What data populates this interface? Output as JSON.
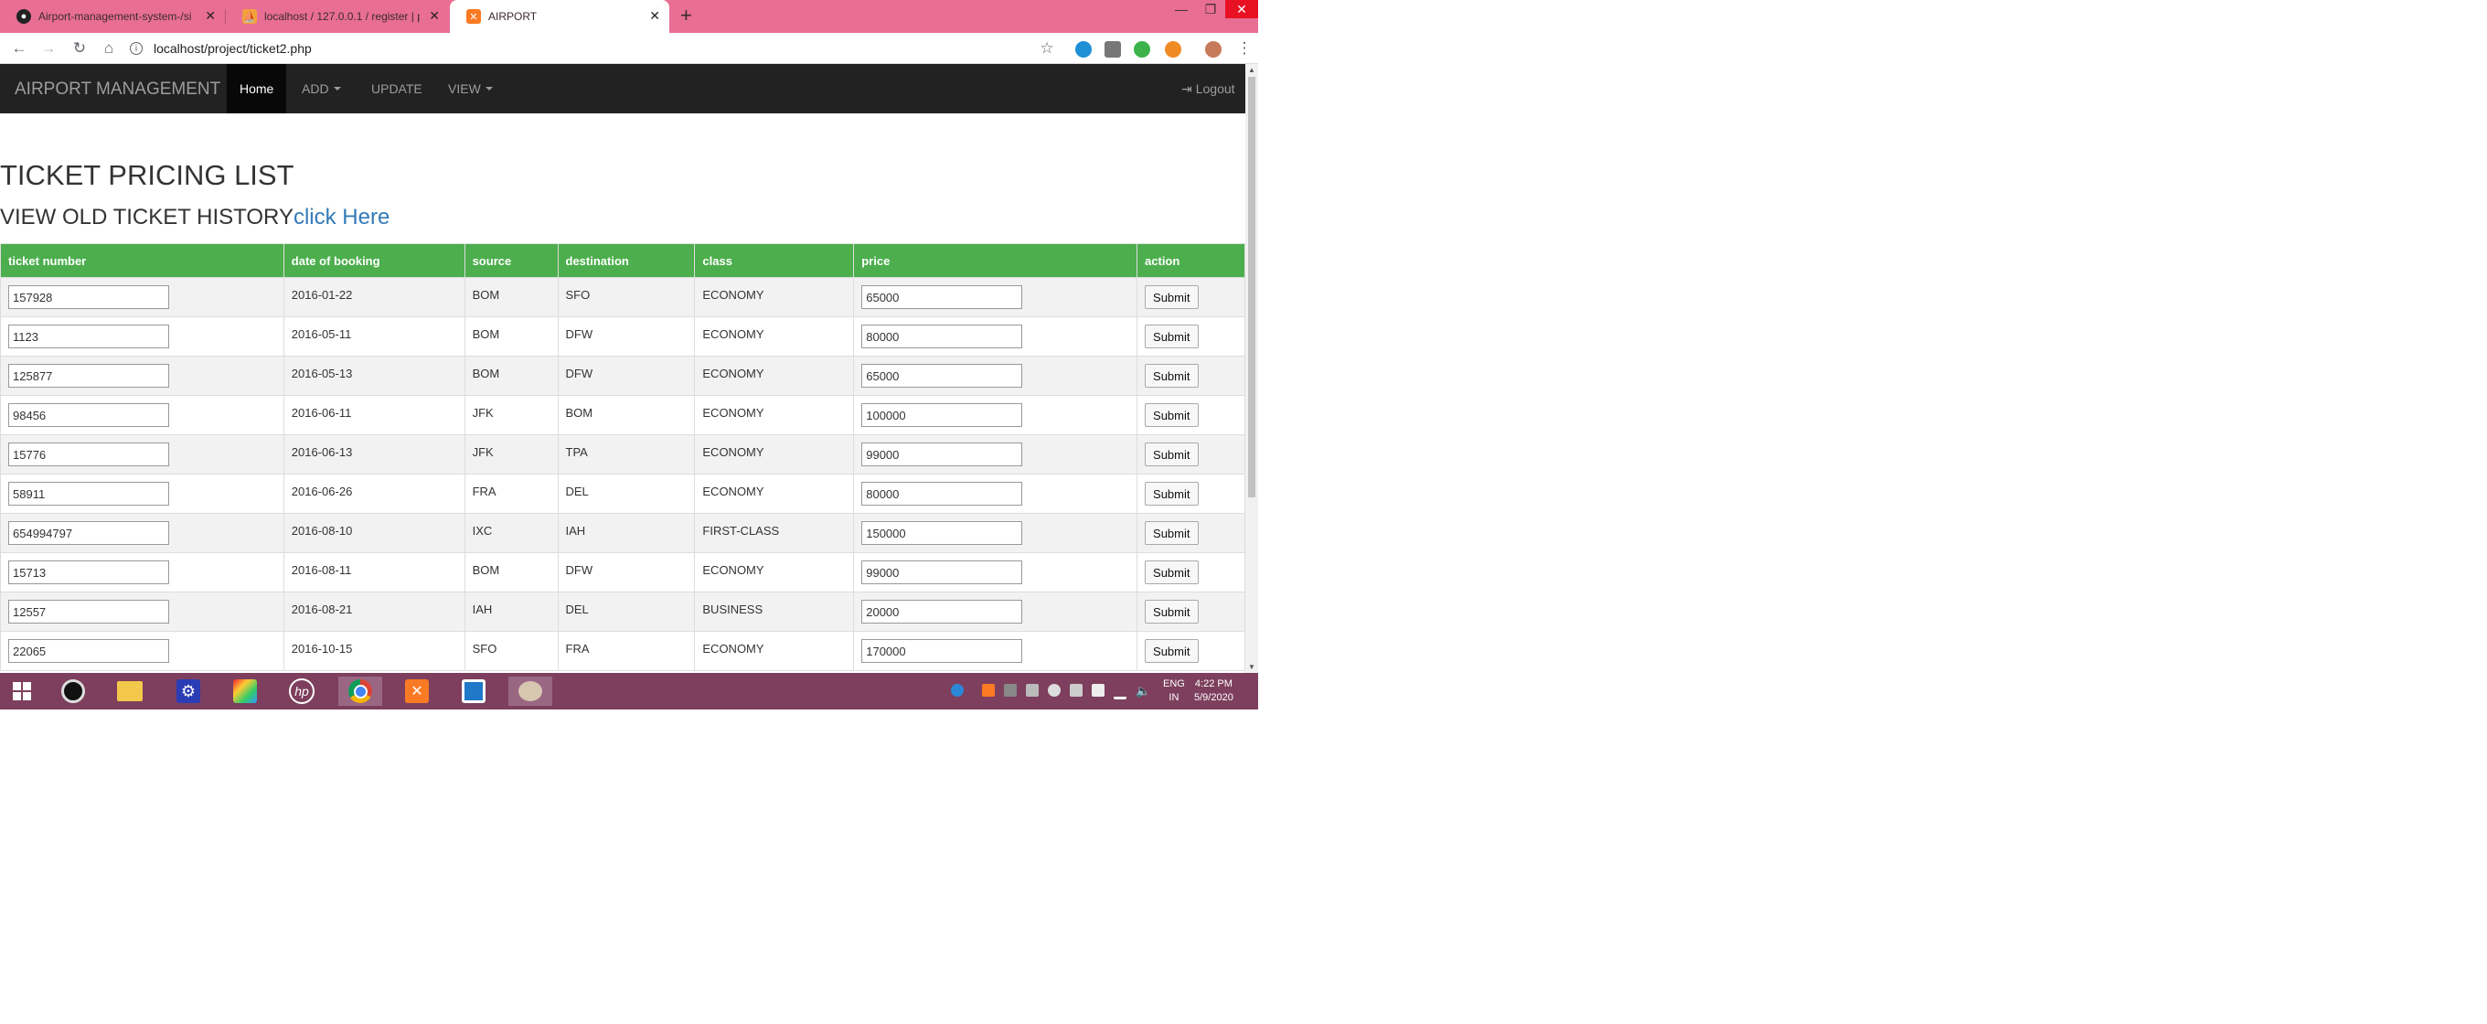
{
  "browser": {
    "tabs": [
      {
        "title": "Airport-management-system-/si",
        "icon": "github-icon"
      },
      {
        "title": "localhost / 127.0.0.1 / register | p",
        "icon": "phpmyadmin-icon"
      },
      {
        "title": "AIRPORT",
        "icon": "xampp-icon"
      }
    ],
    "url": "localhost/project/ticket2.php"
  },
  "navbar": {
    "brand": "AIRPORT MANAGEMENT",
    "home": "Home",
    "add": "ADD",
    "update": "UPDATE",
    "view": "VIEW",
    "logout": "Logout"
  },
  "main": {
    "title": "TICKET PRICING LIST",
    "history_label": "VIEW OLD TICKET HISTORY",
    "history_link": "click Here"
  },
  "table": {
    "headers": [
      "ticket number",
      "date of booking",
      "source",
      "destination",
      "class",
      "price",
      "action"
    ],
    "rows": [
      {
        "ticket": "157928",
        "date": "2016-01-22",
        "source": "BOM",
        "destination": "SFO",
        "class": "ECONOMY",
        "price": "65000",
        "action": "Submit"
      },
      {
        "ticket": "1123",
        "date": "2016-05-11",
        "source": "BOM",
        "destination": "DFW",
        "class": "ECONOMY",
        "price": "80000",
        "action": "Submit"
      },
      {
        "ticket": "125877",
        "date": "2016-05-13",
        "source": "BOM",
        "destination": "DFW",
        "class": "ECONOMY",
        "price": "65000",
        "action": "Submit"
      },
      {
        "ticket": "98456",
        "date": "2016-06-11",
        "source": "JFK",
        "destination": "BOM",
        "class": "ECONOMY",
        "price": "100000",
        "action": "Submit"
      },
      {
        "ticket": "15776",
        "date": "2016-06-13",
        "source": "JFK",
        "destination": "TPA",
        "class": "ECONOMY",
        "price": "99000",
        "action": "Submit"
      },
      {
        "ticket": "58911",
        "date": "2016-06-26",
        "source": "FRA",
        "destination": "DEL",
        "class": "ECONOMY",
        "price": "80000",
        "action": "Submit"
      },
      {
        "ticket": "654994797",
        "date": "2016-08-10",
        "source": "IXC",
        "destination": "IAH",
        "class": "FIRST-CLASS",
        "price": "150000",
        "action": "Submit"
      },
      {
        "ticket": "15713",
        "date": "2016-08-11",
        "source": "BOM",
        "destination": "DFW",
        "class": "ECONOMY",
        "price": "99000",
        "action": "Submit"
      },
      {
        "ticket": "12557",
        "date": "2016-08-21",
        "source": "IAH",
        "destination": "DEL",
        "class": "BUSINESS",
        "price": "20000",
        "action": "Submit"
      },
      {
        "ticket": "22065",
        "date": "2016-10-15",
        "source": "SFO",
        "destination": "FRA",
        "class": "ECONOMY",
        "price": "170000",
        "action": "Submit"
      }
    ]
  },
  "taskbar": {
    "lang": "ENG",
    "region": "IN",
    "time": "4:22 PM",
    "date": "5/9/2020"
  },
  "colors": {
    "titlebar": "#e96e93",
    "navbar": "#222222",
    "table_header": "#4cae4c",
    "link": "#337ab7",
    "taskbar": "#7d3f5d"
  }
}
